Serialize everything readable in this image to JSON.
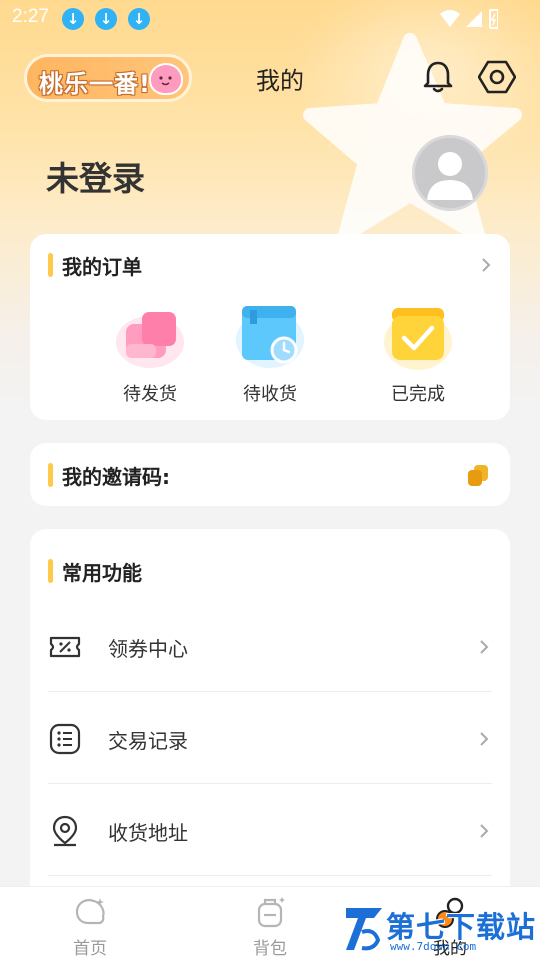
{
  "status_bar": {
    "time": "2:27",
    "download_icon": "↓"
  },
  "header": {
    "logo_text": "桃乐一番!",
    "title": "我的",
    "icons": [
      "bell-icon",
      "settings-hexagon-icon"
    ]
  },
  "profile": {
    "login_status": "未登录",
    "avatar": "default-avatar-icon"
  },
  "orders": {
    "title": "我的订单",
    "items": [
      {
        "label": "待发货",
        "icon": "pink-box-icon",
        "color": "#ff8fb9"
      },
      {
        "label": "待收货",
        "icon": "blue-box-clock-icon",
        "color": "#4fc1f8"
      },
      {
        "label": "已完成",
        "icon": "yellow-box-check-icon",
        "color": "#ffcb3a"
      }
    ]
  },
  "invite": {
    "title": "我的邀请码:"
  },
  "functions": {
    "title": "常用功能",
    "items": [
      {
        "label": "领券中心",
        "icon": "coupon-icon"
      },
      {
        "label": "交易记录",
        "icon": "list-icon"
      },
      {
        "label": "收货地址",
        "icon": "location-pin-icon"
      }
    ]
  },
  "bottom_nav": {
    "items": [
      {
        "label": "首页",
        "icon": "home-icon"
      },
      {
        "label": "背包",
        "icon": "backpack-icon"
      },
      {
        "label": "我的",
        "icon": "profile-icon"
      }
    ]
  },
  "watermark": {
    "text": "第七下载站",
    "url": "www.7down.com"
  },
  "colors": {
    "accent": "#ffc94a",
    "hero_top": "#ffd98e",
    "background": "#f3f3f4"
  }
}
